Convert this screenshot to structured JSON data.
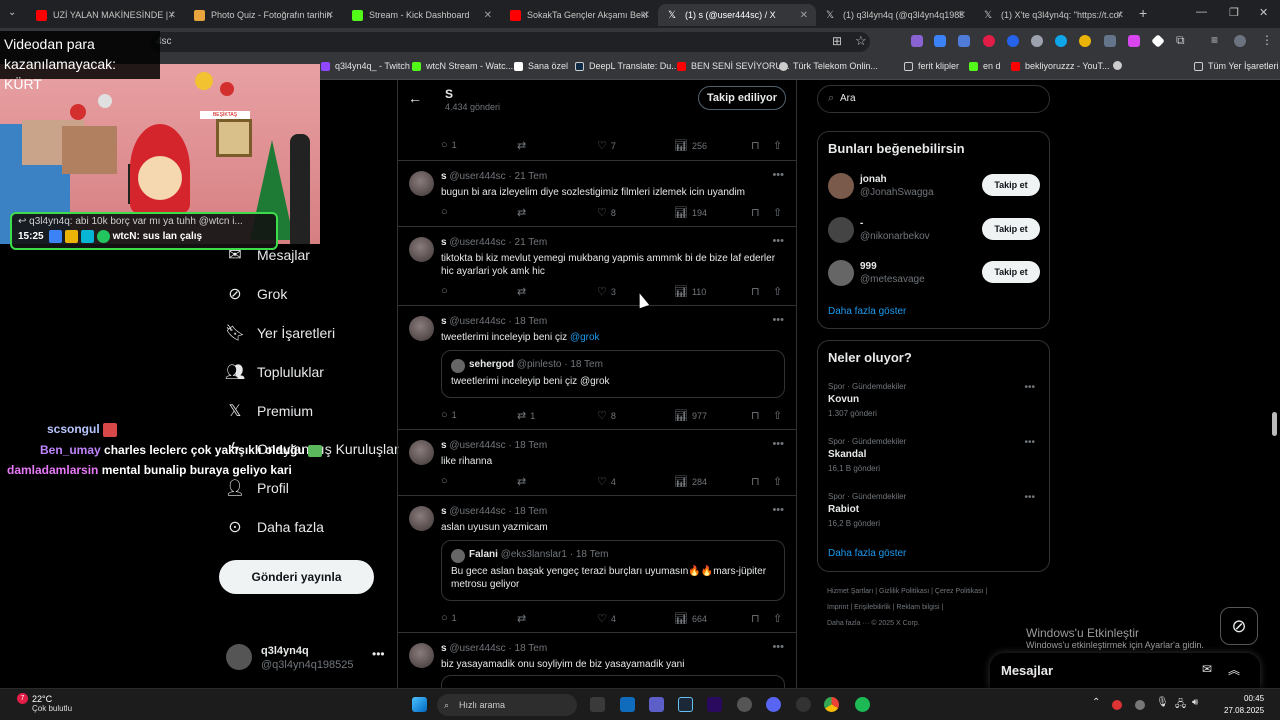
{
  "browser": {
    "tabs": [
      {
        "title": "UZİ YALAN MAKİNESİNDE | #P",
        "color": "#ff0000"
      },
      {
        "title": "Photo Quiz - Fotoğrafın tarihin",
        "color": "#e8a53b"
      },
      {
        "title": "Stream - Kick Dashboard",
        "color": "#53fc18"
      },
      {
        "title": "SokakTa Gençler Akşamı Bekle",
        "color": "#ff0000"
      },
      {
        "title": "(1) s (@user444sc) / X",
        "color": "#ffffff"
      },
      {
        "title": "(1) q3l4yn4q (@q3l4yn4q19852",
        "color": "#ffffff"
      },
      {
        "title": "(1) X'te q3l4yn4q: \"https://t.co/",
        "color": "#ffffff"
      }
    ],
    "new_tab": "+",
    "url_visible": "4sc",
    "bookmarks": [
      {
        "label": "q3l4yn4q_ - Twitch",
        "color": "#9146ff"
      },
      {
        "label": "wtcN Stream - Watc...",
        "color": "#53fc18"
      },
      {
        "label": "Sana özel",
        "color": "#ffffff"
      },
      {
        "label": "DeepL Translate: Du...",
        "color": "#0f2b46"
      },
      {
        "label": "BEN SENİ SEVİYORU...",
        "color": "#ff0000"
      },
      {
        "label": "Türk Telekom Onlin...",
        "color": "#cccccc"
      },
      {
        "label": "ferit klipler",
        "color": "#cccccc"
      },
      {
        "label": "en d",
        "color": "#53fc18"
      },
      {
        "label": "bekliyoruzzz - YouT...",
        "color": "#ff0000"
      }
    ],
    "all_bookmarks": "Tüm Yer İşaretleri"
  },
  "overlay": {
    "title": "Videodan para kazanılamayacak: KÜRT",
    "sign": "BEŞİKTAŞ",
    "chat_alert_line1": "q3l4yn4q: abi 10k borç var mı ya tuhh @wtcn i...",
    "chat_alert_time": "15:25",
    "chat_alert_line2": "wtcN: sus lan çalış"
  },
  "stream_chat": [
    {
      "user": "scsongul",
      "message": "",
      "color": "#b8c6ff"
    },
    {
      "user": "Ben_umay",
      "message": "charles leclerc çok yakışıklı olduğu",
      "color": "#c084fc"
    },
    {
      "user": "damladamlarsin",
      "message": "mental bunalip buraya geliyo kari",
      "color": "#e879f9"
    }
  ],
  "nav": {
    "items": [
      {
        "label": "Mesajlar",
        "icon": "mail-icon"
      },
      {
        "label": "Grok",
        "icon": "grok-icon"
      },
      {
        "label": "Yer İşaretleri",
        "icon": "bookmark-icon"
      },
      {
        "label": "Topluluklar",
        "icon": "people-icon"
      },
      {
        "label": "Premium",
        "icon": "x-logo-icon"
      },
      {
        "label": "Onaylanmış Kuruluşlar",
        "icon": "lightning-icon"
      },
      {
        "label": "Profil",
        "icon": "person-icon"
      },
      {
        "label": "Daha fazla",
        "icon": "more-circle-icon"
      }
    ],
    "post_button": "Gönderi yayınla",
    "account_name": "q3l4yn4q",
    "account_handle": "@q3l4yn4q198525"
  },
  "profile_header": {
    "name": "S",
    "posts": "4.434 gönderi",
    "follow_button": "Takip ediliyor"
  },
  "tweets": [
    {
      "name": "",
      "handle": "",
      "date": "",
      "text": "",
      "replies": "1",
      "reposts": "",
      "likes": "7",
      "views": "256"
    },
    {
      "name": "s",
      "handle": "@user444sc",
      "date": "21 Tem",
      "text": "bugun bi ara izleyelim diye sozlestigimiz filmleri izlemek icin uyandim",
      "replies": "",
      "reposts": "",
      "likes": "8",
      "views": "194"
    },
    {
      "name": "s",
      "handle": "@user444sc",
      "date": "21 Tem",
      "text": "tiktokta bi kiz mevlut yemegi mukbang yapmis ammmk bi de bize laf ederler hic ayarlari yok amk hic",
      "replies": "",
      "reposts": "",
      "likes": "3",
      "views": "110"
    },
    {
      "name": "s",
      "handle": "@user444sc",
      "date": "18 Tem",
      "text": "tweetlerimi inceleyip beni çiz ",
      "mention": "@grok",
      "quote": {
        "name": "sehergod",
        "handle": "@pinlesto",
        "date": "18 Tem",
        "text": "tweetlerimi inceleyip beni çiz @grok"
      },
      "replies": "1",
      "reposts": "1",
      "likes": "8",
      "views": "977"
    },
    {
      "name": "s",
      "handle": "@user444sc",
      "date": "18 Tem",
      "text": "like rihanna",
      "replies": "",
      "reposts": "",
      "likes": "4",
      "views": "284"
    },
    {
      "name": "s",
      "handle": "@user444sc",
      "date": "18 Tem",
      "text": "aslan uyusun yazmicam",
      "quote": {
        "name": "Falani",
        "handle": "@eks3lanslar1",
        "date": "18 Tem",
        "text": "Bu gece aslan başak yengeç terazi burçları uyumasın🔥🔥mars-jüpiter metrosu geliyor"
      },
      "replies": "1",
      "reposts": "",
      "likes": "4",
      "views": "664"
    },
    {
      "name": "s",
      "handle": "@user444sc",
      "date": "18 Tem",
      "text": "biz yasayamadik onu soyliyim de biz yasayamadik yani",
      "replies": "",
      "reposts": "",
      "likes": "",
      "views": ""
    }
  ],
  "sidebar": {
    "search_placeholder": "Ara",
    "who_to_follow_title": "Bunları beğenebilirsin",
    "who_to_follow": [
      {
        "name": "jonah",
        "handle": "@JonahSwagga",
        "button": "Takip et",
        "color": "#7a5a4a"
      },
      {
        "name": "-",
        "handle": "@nikonarbekov",
        "button": "Takip et",
        "color": "#444444"
      },
      {
        "name": "999",
        "handle": "@metesavage",
        "button": "Takip et",
        "color": "#666666"
      }
    ],
    "show_more": "Daha fazla göster",
    "trends_title": "Neler oluyor?",
    "trends": [
      {
        "category": "Spor · Gündemdekiler",
        "title": "Kovun",
        "count": "1.307 gönderi"
      },
      {
        "category": "Spor · Gündemdekiler",
        "title": "Skandal",
        "count": "16,1 B gönderi"
      },
      {
        "category": "Spor · Gündemdekiler",
        "title": "Rabiot",
        "count": "16,2 B gönderi"
      }
    ],
    "trends_show_more": "Daha fazla göster",
    "footer": [
      "Hizmet Şartları",
      "Gizlilik Politikası",
      "Çerez Politikası",
      "Imprint",
      "Erişilebilirlik",
      "Reklam bilgisi",
      "Daha fazla ···",
      "© 2025 X Corp."
    ]
  },
  "windows": {
    "activate_title": "Windows'u Etkinleştir",
    "activate_sub": "Windows'u etkinleştirmek için Ayarlar'a gidin.",
    "messages_drawer": "Mesajlar",
    "weather_temp": "22°C",
    "weather_desc": "Çok bulutlu",
    "weather_badge": "7",
    "taskbar_search": "Hızlı arama",
    "time": "00:45",
    "date": "27.08.2025"
  }
}
